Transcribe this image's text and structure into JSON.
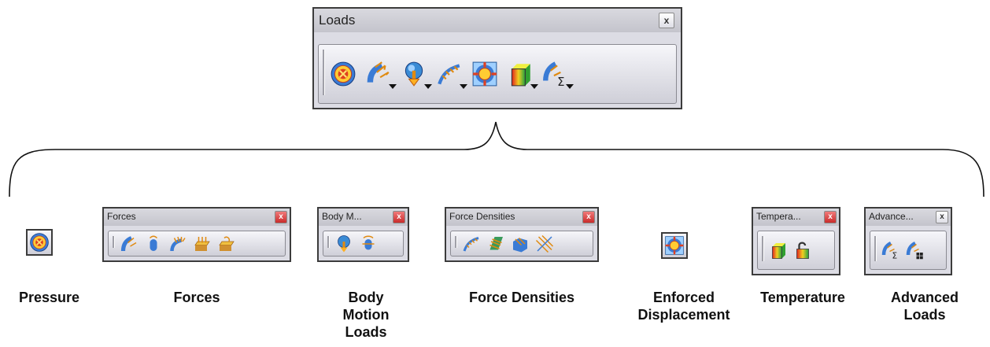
{
  "main_toolbar": {
    "title": "Loads",
    "close": "x",
    "icons": [
      "pressure-icon",
      "force-icon",
      "body-motion-icon",
      "force-density-icon",
      "enforced-displacement-icon",
      "temperature-icon",
      "advanced-loads-icon"
    ]
  },
  "sub_toolbars": {
    "pressure": {
      "icon": "pressure-icon",
      "label": "Pressure"
    },
    "forces": {
      "title": "Forces",
      "close": "x",
      "label": "Forces",
      "icons": [
        "distributed-force-icon",
        "moment-icon",
        "bearing-load-icon",
        "imported-force-icon",
        "imported-moment-icon"
      ]
    },
    "body_motion": {
      "title": "Body M...",
      "close": "x",
      "label": "Body Motion Loads",
      "icons": [
        "acceleration-icon",
        "rotation-force-icon"
      ]
    },
    "force_densities": {
      "title": "Force Densities",
      "close": "x",
      "label": "Force Densities",
      "icons": [
        "line-force-density-icon",
        "surface-force-density-icon",
        "volume-force-density-icon",
        "force-density-vector-icon"
      ]
    },
    "enforced": {
      "icon": "enforced-displacement-icon",
      "label": "Enforced Displacement"
    },
    "temperature": {
      "title": "Tempera...",
      "close": "x",
      "label": "Temperature",
      "icons": [
        "temperature-field-icon",
        "imported-temperature-icon"
      ]
    },
    "advanced": {
      "title": "Advance...",
      "close": "x",
      "label": "Advanced Loads",
      "icons": [
        "load-combination-icon",
        "advanced-sum-icon"
      ]
    }
  },
  "colors": {
    "toolbar_bg": "#dcdce4",
    "border": "#3c3c3c",
    "close_red": "#d94040"
  }
}
